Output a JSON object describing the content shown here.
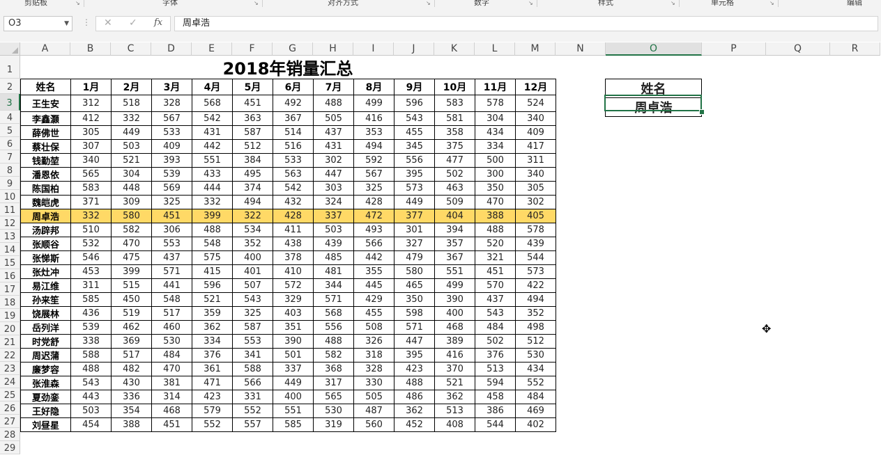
{
  "ribbon_groups": [
    "剪贴板",
    "字体",
    "对齐方式",
    "数字",
    "样式",
    "单元格",
    "编辑"
  ],
  "namebox": {
    "value": "O3"
  },
  "formula_bar": {
    "cancel_icon": "✕",
    "enter_icon": "✓",
    "fx_label": "fx",
    "value": "周卓浩"
  },
  "columns": [
    "A",
    "B",
    "C",
    "D",
    "E",
    "F",
    "G",
    "H",
    "I",
    "J",
    "K",
    "L",
    "M",
    "N",
    "O",
    "P",
    "Q",
    "R"
  ],
  "rows": [
    "1",
    "2",
    "3",
    "4",
    "5",
    "6",
    "7",
    "8",
    "9",
    "10",
    "11",
    "12",
    "13",
    "14",
    "15",
    "16",
    "17",
    "18",
    "19",
    "20",
    "21",
    "22",
    "23",
    "24",
    "25",
    "26",
    "27",
    "28",
    "29"
  ],
  "sheet": {
    "title": "2018年销量汇总",
    "headers": [
      "姓名",
      "1月",
      "2月",
      "3月",
      "4月",
      "5月",
      "6月",
      "7月",
      "8月",
      "9月",
      "10月",
      "11月",
      "12月"
    ],
    "records": [
      [
        "王生安",
        "312",
        "518",
        "328",
        "568",
        "451",
        "492",
        "488",
        "499",
        "596",
        "583",
        "578",
        "524"
      ],
      [
        "李鑫灏",
        "412",
        "332",
        "567",
        "542",
        "363",
        "367",
        "505",
        "416",
        "543",
        "581",
        "304",
        "340"
      ],
      [
        "薛佛世",
        "305",
        "449",
        "533",
        "431",
        "587",
        "514",
        "437",
        "353",
        "455",
        "358",
        "434",
        "409"
      ],
      [
        "蔡壮保",
        "307",
        "503",
        "409",
        "442",
        "512",
        "516",
        "431",
        "494",
        "345",
        "375",
        "334",
        "417"
      ],
      [
        "钱勤堃",
        "340",
        "521",
        "393",
        "551",
        "384",
        "533",
        "302",
        "592",
        "556",
        "477",
        "500",
        "311"
      ],
      [
        "潘恩依",
        "565",
        "304",
        "539",
        "433",
        "495",
        "563",
        "447",
        "567",
        "395",
        "502",
        "300",
        "340"
      ],
      [
        "陈国柏",
        "583",
        "448",
        "569",
        "444",
        "374",
        "542",
        "303",
        "325",
        "573",
        "463",
        "350",
        "305"
      ],
      [
        "魏皑虎",
        "371",
        "309",
        "325",
        "332",
        "494",
        "432",
        "324",
        "428",
        "449",
        "509",
        "470",
        "302"
      ],
      [
        "周卓浩",
        "332",
        "580",
        "451",
        "399",
        "322",
        "428",
        "337",
        "472",
        "377",
        "404",
        "388",
        "405"
      ],
      [
        "汤辟邦",
        "510",
        "582",
        "306",
        "488",
        "534",
        "411",
        "503",
        "493",
        "301",
        "394",
        "488",
        "578"
      ],
      [
        "张顺谷",
        "532",
        "470",
        "553",
        "548",
        "352",
        "438",
        "439",
        "566",
        "327",
        "357",
        "520",
        "439"
      ],
      [
        "张悌斯",
        "546",
        "475",
        "437",
        "575",
        "400",
        "378",
        "485",
        "442",
        "479",
        "367",
        "321",
        "544"
      ],
      [
        "张灶冲",
        "453",
        "399",
        "571",
        "415",
        "401",
        "410",
        "481",
        "355",
        "580",
        "551",
        "451",
        "573"
      ],
      [
        "易江维",
        "311",
        "515",
        "441",
        "596",
        "507",
        "572",
        "344",
        "445",
        "465",
        "499",
        "570",
        "422"
      ],
      [
        "孙来笙",
        "585",
        "450",
        "548",
        "521",
        "543",
        "329",
        "571",
        "429",
        "350",
        "390",
        "437",
        "494"
      ],
      [
        "饶展林",
        "436",
        "519",
        "517",
        "359",
        "325",
        "403",
        "568",
        "455",
        "598",
        "400",
        "543",
        "352"
      ],
      [
        "岳列洋",
        "539",
        "462",
        "460",
        "362",
        "587",
        "351",
        "556",
        "508",
        "571",
        "468",
        "484",
        "498"
      ],
      [
        "时党舒",
        "338",
        "369",
        "530",
        "334",
        "553",
        "390",
        "488",
        "326",
        "447",
        "389",
        "502",
        "512"
      ],
      [
        "周迟蒲",
        "588",
        "517",
        "484",
        "376",
        "341",
        "501",
        "582",
        "318",
        "395",
        "416",
        "376",
        "530"
      ],
      [
        "廉梦容",
        "488",
        "482",
        "470",
        "361",
        "588",
        "337",
        "368",
        "328",
        "423",
        "370",
        "513",
        "434"
      ],
      [
        "张淮森",
        "543",
        "430",
        "381",
        "471",
        "566",
        "449",
        "317",
        "330",
        "488",
        "521",
        "594",
        "552"
      ],
      [
        "夏劲銮",
        "443",
        "336",
        "314",
        "423",
        "331",
        "400",
        "565",
        "505",
        "486",
        "362",
        "458",
        "484"
      ],
      [
        "王好隐",
        "503",
        "354",
        "468",
        "579",
        "552",
        "551",
        "530",
        "487",
        "362",
        "513",
        "386",
        "469"
      ],
      [
        "刘昼星",
        "454",
        "388",
        "451",
        "552",
        "557",
        "585",
        "319",
        "560",
        "452",
        "408",
        "544",
        "402"
      ]
    ],
    "highlight_name": "周卓浩"
  },
  "lookup": {
    "header": "姓名",
    "value": "周卓浩"
  },
  "colors": {
    "highlight": "#ffd966",
    "selection": "#217346"
  }
}
